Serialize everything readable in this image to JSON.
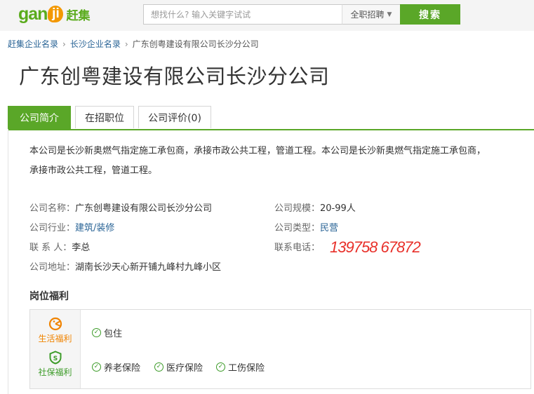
{
  "header": {
    "logo_latin": "gan",
    "logo_badge": "ji",
    "logo_cn": "赶集",
    "search_placeholder": "想找什么? 输入关键字试试",
    "category": "全职招聘",
    "search_button": "搜索"
  },
  "breadcrumb": [
    "赶集企业名录",
    "长沙企业名录",
    "广东创粤建设有限公司长沙分公司"
  ],
  "title": "广东创粤建设有限公司长沙分公司",
  "tabs": [
    "公司简介",
    "在招职位",
    "公司评价(0)"
  ],
  "intro": "本公司是长沙新奥燃气指定施工承包商，承接市政公共工程，管道工程。本公司是长沙新奥燃气指定施工承包商，承接市政公共工程，管道工程。",
  "info": {
    "name_label": "公司名称：",
    "name": "广东创粤建设有限公司长沙分公司",
    "industry_label": "公司行业：",
    "industry": "建筑/装修",
    "contact_label": "联 系 人：",
    "contact": "李总",
    "address_label": "公司地址：",
    "address": "湖南长沙天心新开铺九峰村九峰小区",
    "size_label": "公司规模：",
    "size": "20-99人",
    "type_label": "公司类型：",
    "type": "民营",
    "phone_label": "联系电话：",
    "phone": "139758 67872"
  },
  "welfare": {
    "title": "岗位福利",
    "life_label": "生活福利",
    "life_items": [
      "包住"
    ],
    "social_label": "社保福利",
    "social_items": [
      "养老保险",
      "医疗保险",
      "工伤保险"
    ]
  },
  "colors": {
    "brand_green": "#5aa728",
    "link_blue": "#2a6496",
    "phone_red": "#e8302a",
    "life_orange": "#f08300"
  }
}
